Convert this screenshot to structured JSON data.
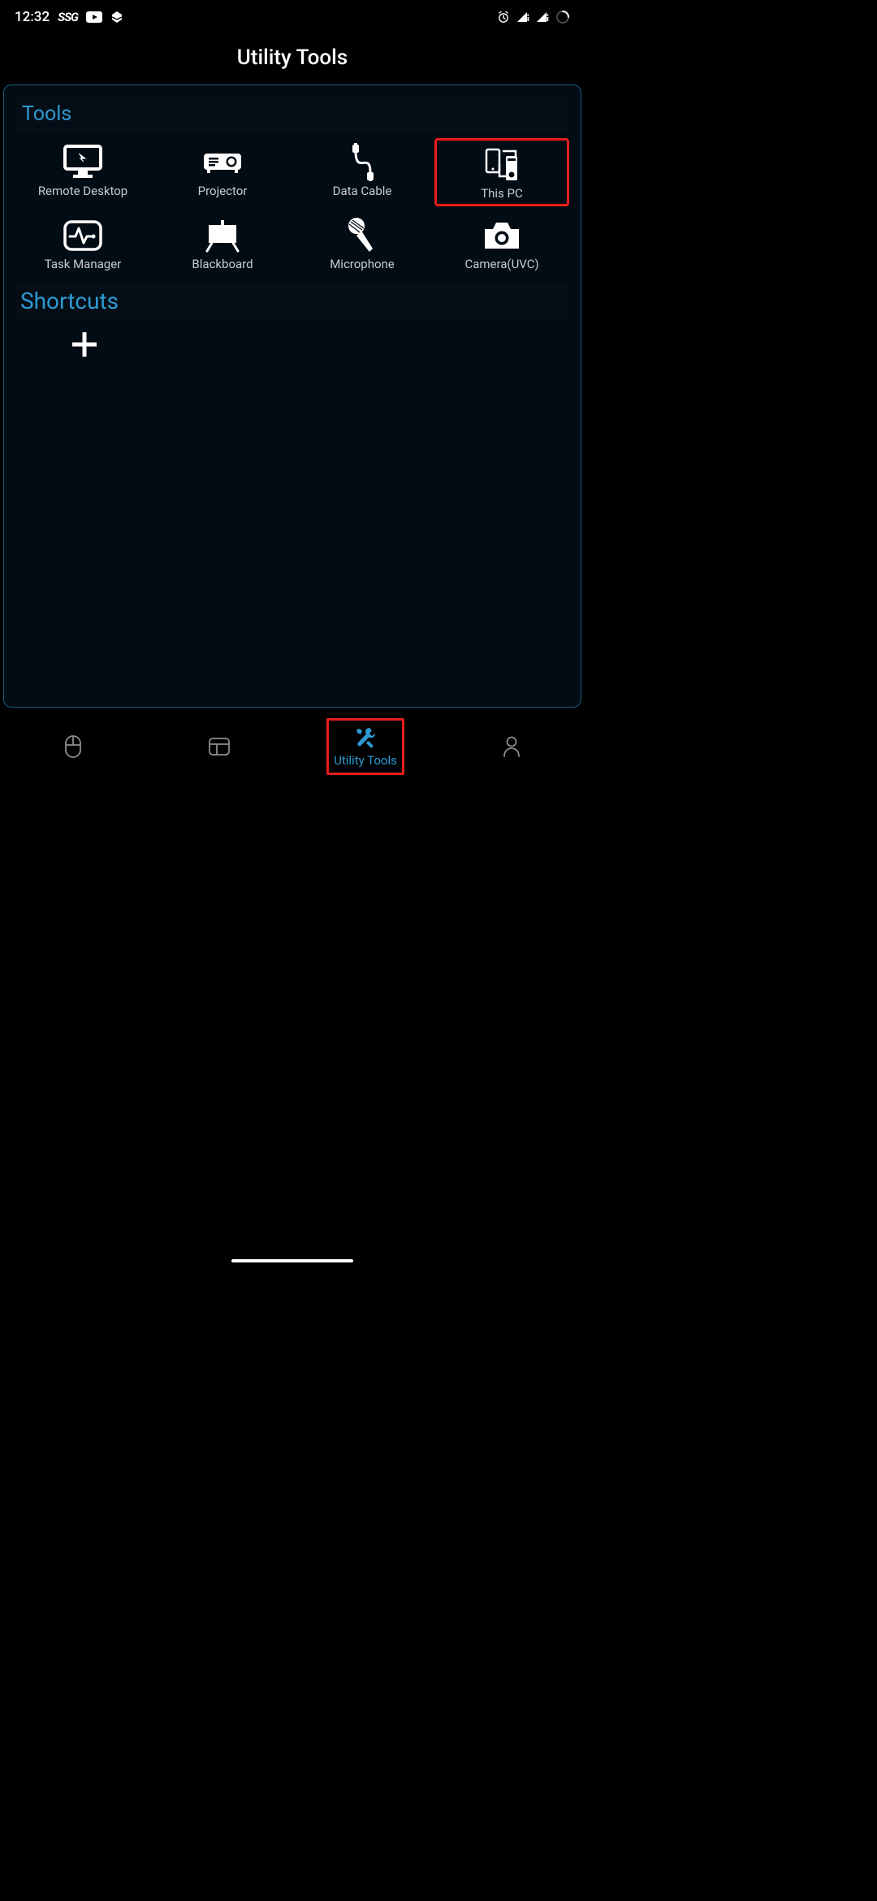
{
  "status": {
    "time": "12:32",
    "ssg": "SSG"
  },
  "header": {
    "title": "Utility Tools"
  },
  "sections": {
    "tools_title": "Tools",
    "shortcuts_title": "Shortcuts",
    "items": [
      {
        "label": "Remote Desktop"
      },
      {
        "label": "Projector"
      },
      {
        "label": "Data Cable"
      },
      {
        "label": "This PC"
      },
      {
        "label": "Task Manager"
      },
      {
        "label": "Blackboard"
      },
      {
        "label": "Microphone"
      },
      {
        "label": "Camera(UVC)"
      }
    ]
  },
  "nav": {
    "utility_label": "Utility Tools"
  }
}
